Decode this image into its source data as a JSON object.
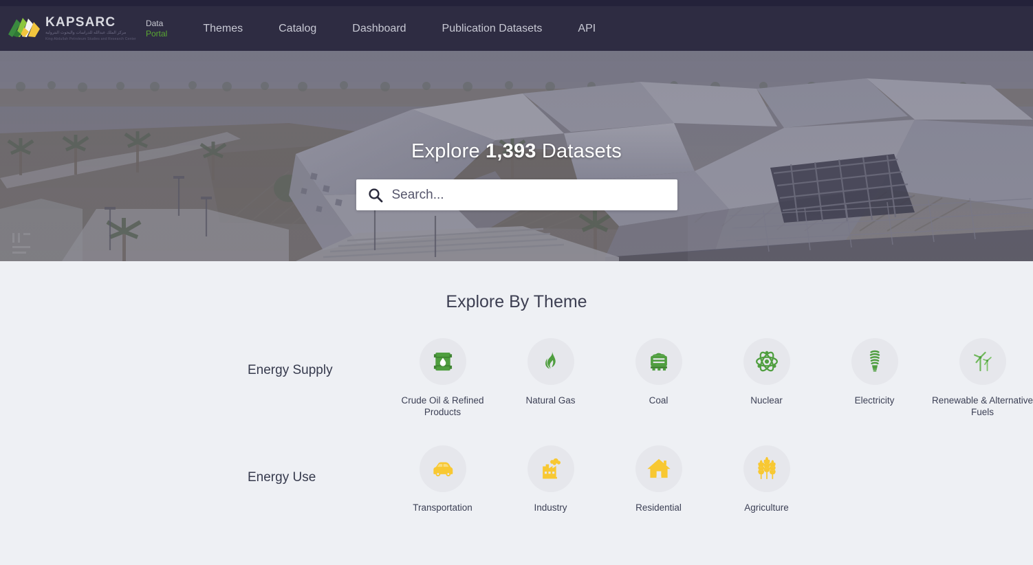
{
  "brand": {
    "logo_icon": "kapsarc-logo-mark",
    "name": "KAPSARC",
    "arabic_line1": "مركز الملك عبدالله للدراسات والبحوث البترولية",
    "arabic_line2": "King Abdullah Petroleum Studies and Research Center",
    "portal_line1": "Data",
    "portal_line2": "Portal",
    "portal_accent_color": "#5aa832"
  },
  "nav": {
    "items": [
      {
        "label": "Themes",
        "name": "nav-item-themes"
      },
      {
        "label": "Catalog",
        "name": "nav-item-catalog"
      },
      {
        "label": "Dashboard",
        "name": "nav-item-dashboard"
      },
      {
        "label": "Publication Datasets",
        "name": "nav-item-publication-datasets"
      },
      {
        "label": "API",
        "name": "nav-item-api"
      }
    ]
  },
  "hero": {
    "title_prefix": "Explore ",
    "dataset_count": "1,393",
    "title_suffix": " Datasets",
    "search_placeholder": "Search...",
    "search_value": "",
    "search_icon": "search-icon",
    "background_image": "kapsarc-building-aerial-photo"
  },
  "main": {
    "section_title": "Explore By Theme",
    "rows": [
      {
        "label": "Energy Supply",
        "accent_color": "#4f9e3f",
        "tiles": [
          {
            "label": "Crude Oil & Refined Products",
            "icon": "oil-barrel-icon"
          },
          {
            "label": "Natural Gas",
            "icon": "flame-icon"
          },
          {
            "label": "Coal",
            "icon": "coal-wagon-icon"
          },
          {
            "label": "Nuclear",
            "icon": "atom-icon"
          },
          {
            "label": "Electricity",
            "icon": "cfl-bulb-icon"
          },
          {
            "label": "Renewable & Alternative Fuels",
            "icon": "wind-turbine-icon"
          }
        ]
      },
      {
        "label": "Energy Use",
        "accent_color": "#f8c832",
        "tiles": [
          {
            "label": "Transportation",
            "icon": "car-icon"
          },
          {
            "label": "Industry",
            "icon": "factory-icon"
          },
          {
            "label": "Residential",
            "icon": "house-icon"
          },
          {
            "label": "Agriculture",
            "icon": "wheat-icon"
          }
        ]
      }
    ]
  },
  "colors": {
    "header_bg": "#2e2c42",
    "top_strip": "#24223a",
    "page_bg": "#eef0f4",
    "green": "#4f9e3f",
    "yellow": "#f8c832"
  }
}
